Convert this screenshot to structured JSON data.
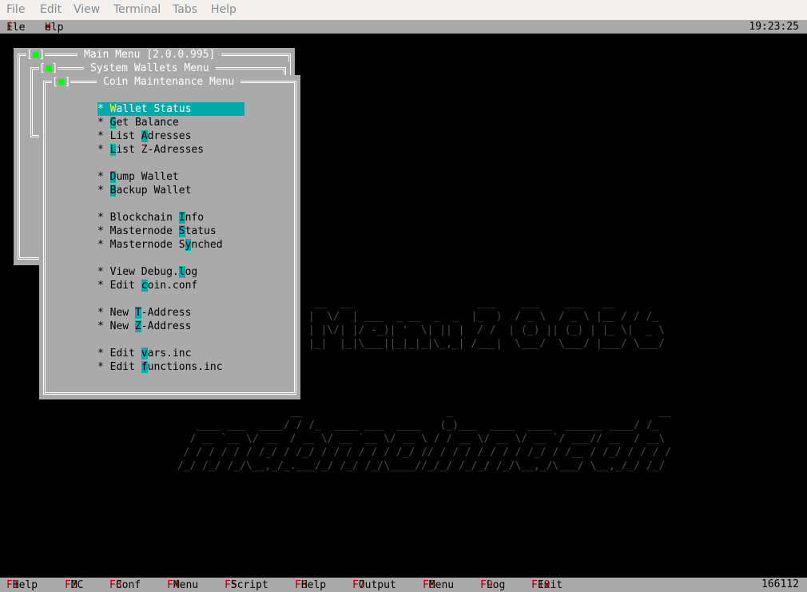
{
  "gtk_menu": [
    "File",
    "Edit",
    "View",
    "Terminal",
    "Tabs",
    "Help"
  ],
  "topbar": {
    "file_hot": "F",
    "file_rest": "ile",
    "help_hot": "H",
    "help_rest": "elp",
    "clock": "19:23:25"
  },
  "windows": {
    "main": "Main Menu [2.0.0.995]",
    "system": "System Wallets Menu",
    "coin": "Coin Maintenance Menu",
    "close_box": "■"
  },
  "menu_items": [
    {
      "pre": "",
      "hot": "W",
      "post": "allet Status"
    },
    {
      "pre": "",
      "hot": "G",
      "post": "et Balance"
    },
    {
      "pre": "List ",
      "hot": "A",
      "post": "dresses"
    },
    {
      "pre": "",
      "hot": "L",
      "post": "ist Z-Adresses"
    },
    {
      "pre": "",
      "hot": "D",
      "post": "ump Wallet"
    },
    {
      "pre": "",
      "hot": "B",
      "post": "ackup Wallet"
    },
    {
      "pre": "Blockchain ",
      "hot": "I",
      "post": "nfo"
    },
    {
      "pre": "Masternode ",
      "hot": "S",
      "post": "tatus"
    },
    {
      "pre": "Masternode S",
      "hot": "y",
      "post": "nched"
    },
    {
      "pre": "View Debug.",
      "hot": "l",
      "post": "og"
    },
    {
      "pre": "Edit ",
      "hot": "c",
      "post": "oin.conf"
    },
    {
      "pre": "New ",
      "hot": "T",
      "post": "-Address"
    },
    {
      "pre": "New ",
      "hot": "Z",
      "post": "-Address"
    },
    {
      "pre": "Edit ",
      "hot": "v",
      "post": "ars.inc"
    },
    {
      "pre": "Edit ",
      "hot": "f",
      "post": "unctions.inc"
    }
  ],
  "bullet": "* ",
  "function_keys": [
    {
      "key": "F1",
      "label": "Help"
    },
    {
      "key": "F2",
      "label": "MC"
    },
    {
      "key": "F3",
      "label": "Conf"
    },
    {
      "key": "F4",
      "label": "Menu"
    },
    {
      "key": "F5",
      "label": "Script"
    },
    {
      "key": "F6",
      "label": "Help"
    },
    {
      "key": "F7",
      "label": "Output"
    },
    {
      "key": "F8",
      "label": "Menu"
    },
    {
      "key": "F9",
      "label": "Log"
    },
    {
      "key": "F10",
      "label": "Exit"
    }
  ],
  "counter": "166112",
  "banner_line1": "  __  __                    ___    ___    ___   __  \n |  \\/  | ___  _ __  _  _  |_  )  / _ \\  / _ \\ |__ / / /_ \n | |\\/| |/ -_)| '  \\| || |  / /  | (_) || (_) | |_ \\|  _ \\\n |_|  |_|\\___||_|_|_|\\_,_| /___|  \\___/  \\___/ |___/ \\___/",
  "banner_line2": "                   __                       _                                 __\n    ____ ___  ____/ / /_  ____ ___  ____   (_)___  ____  ____  ______ ____/ /_\n   / __ `__ \\/ __  / __ \\/ __ `__ \\/ __ \\ / / __ \\/ __ \\/ __ `/ ___// __  / __\\\n  / / / / / / /_/ / /_/ / / / / / / /_/ // / / / / / / / /_/ / /__ / /_/ / / / /\n /_/ /_/ /_/\\__,_/_.___/_/ /_/ /_/\\____//_/_/ /_/_/ /_/\\__,_/\\___/ \\__,_/_/ /_/"
}
